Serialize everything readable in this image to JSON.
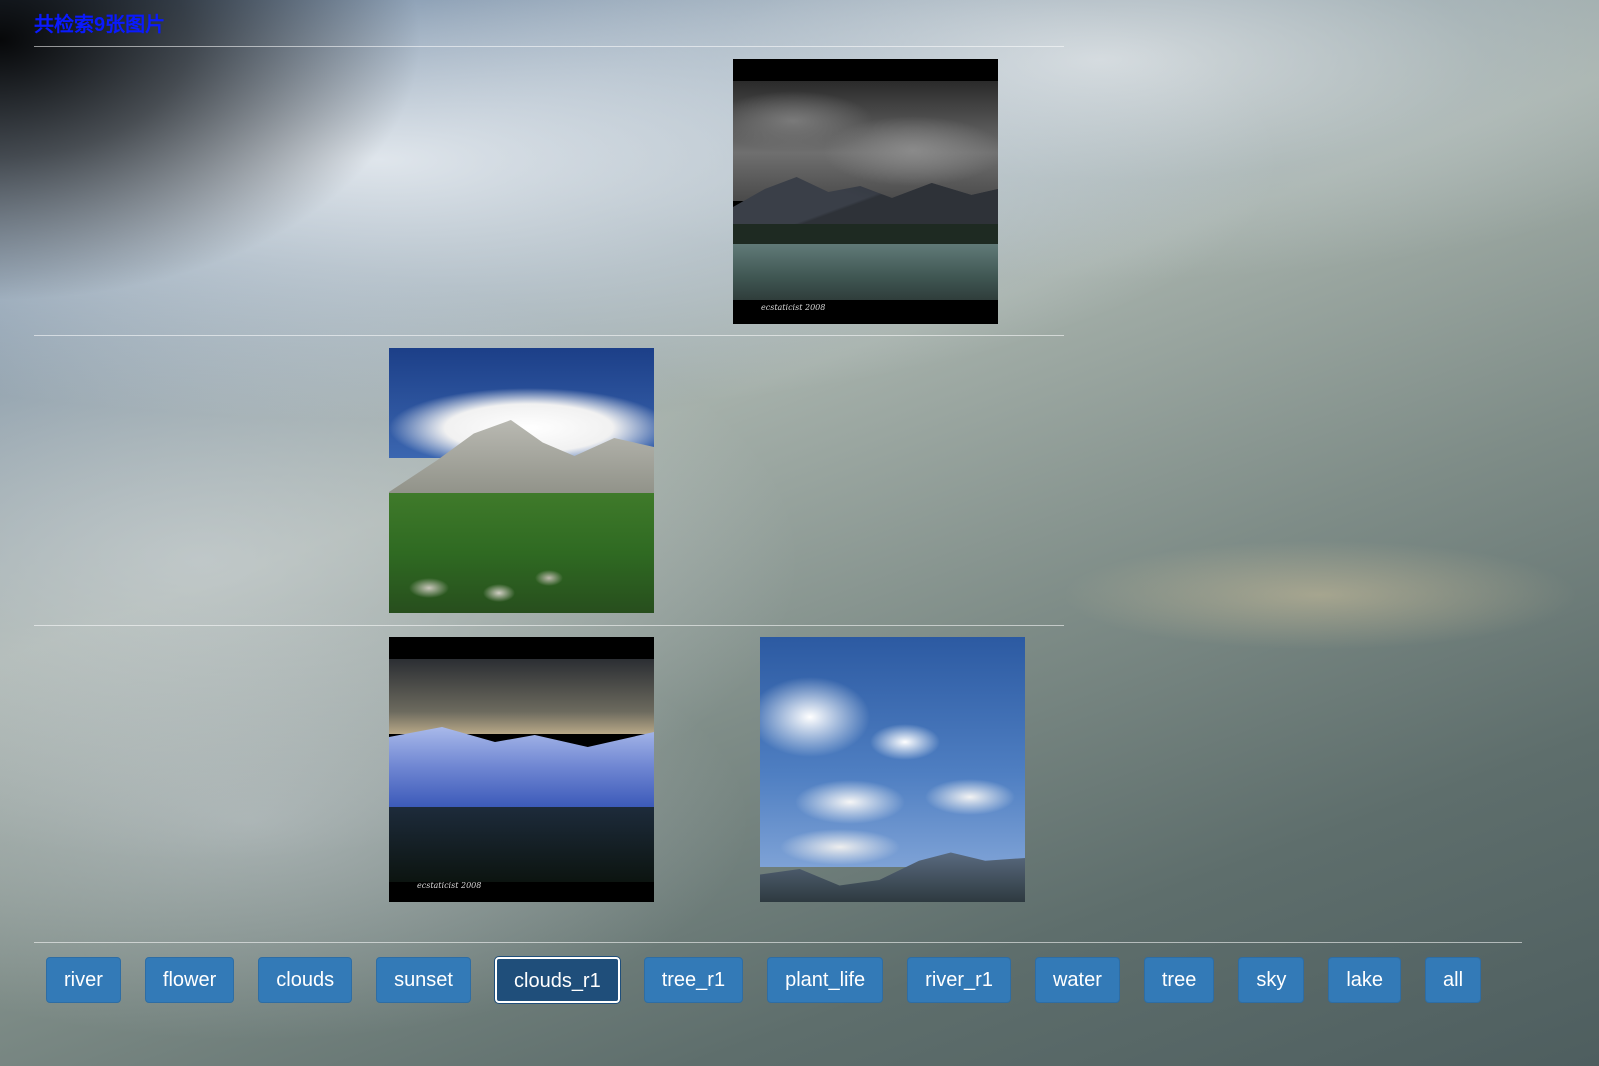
{
  "header": {
    "count_label": "共检索9张图片"
  },
  "gallery": {
    "images": [
      {
        "name": "stormy-lake",
        "caption": "ecstaticist 2008"
      },
      {
        "name": "mountain-meadow",
        "caption": ""
      },
      {
        "name": "snowy-mountains",
        "caption": "ecstaticist 2008"
      },
      {
        "name": "blue-sky-clouds",
        "caption": ""
      }
    ]
  },
  "tags": {
    "items": [
      "river",
      "flower",
      "clouds",
      "sunset",
      "clouds_r1",
      "tree_r1",
      "plant_life",
      "river_r1",
      "water",
      "tree",
      "sky",
      "lake",
      "all"
    ],
    "selected": "clouds_r1"
  },
  "colors": {
    "count_label": "#0a1aff",
    "tag_background": "#337ab7",
    "tag_selected_background": "#1f4e7a",
    "tag_text": "#ffffff"
  }
}
